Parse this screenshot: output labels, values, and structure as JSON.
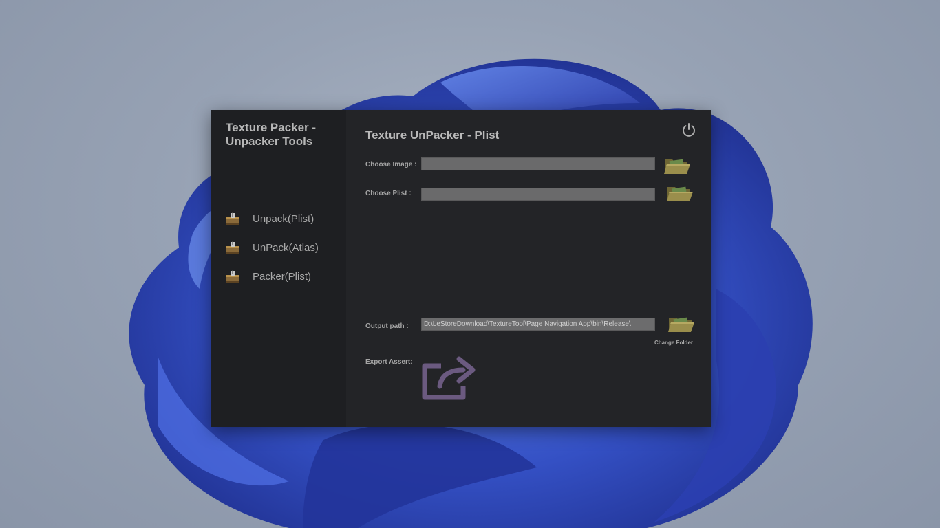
{
  "colors": {
    "window_bg": "#222326",
    "sidebar_bg": "#1e1f22",
    "text": "#b7b7b7",
    "field_bg": "#6a6a6b",
    "export_icon": "#6b5a80",
    "folder_icon": "#8a8048"
  },
  "sidebar": {
    "title": "Texture Packer -\nUnpacker Tools",
    "items": [
      {
        "label": "Unpack(Plist)",
        "icon": "archive-box-icon"
      },
      {
        "label": "UnPack(Atlas)",
        "icon": "archive-box-icon"
      },
      {
        "label": "Packer(Plist)",
        "icon": "archive-box-icon"
      }
    ]
  },
  "main": {
    "title": "Texture UnPacker - Plist",
    "power_icon": "power-icon",
    "choose_image": {
      "label": "Choose Image :",
      "value": ""
    },
    "choose_plist": {
      "label": "Choose Plist :",
      "value": ""
    },
    "output_path": {
      "label": "Output path :",
      "value": "D:\\LeStoreDownload\\TextureTool\\Page Navigation App\\bin\\Release\\"
    },
    "change_folder_label": "Change Folder",
    "export_label": "Export Assert:",
    "export_icon": "share-export-icon",
    "folder_icon": "open-folder-icon"
  }
}
